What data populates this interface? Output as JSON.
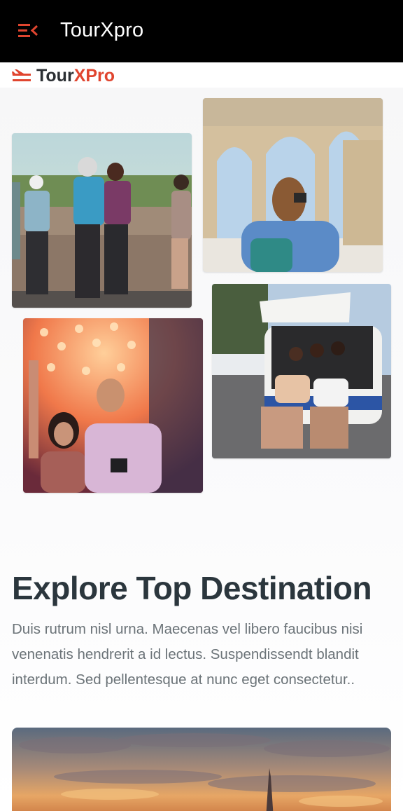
{
  "appbar": {
    "title": "TourXpro",
    "menu_icon": "menu-close-icon",
    "accent_color": "#e0452f"
  },
  "brand": {
    "name_part1": "Tour",
    "name_part2": "XPro",
    "logo_icon": "plane-logo-icon",
    "accent_color": "#e0452f"
  },
  "gallery": {
    "photos": [
      {
        "name": "tourists-photographing-view"
      },
      {
        "name": "woman-photographing-arches"
      },
      {
        "name": "friends-on-van"
      },
      {
        "name": "couple-under-lights"
      }
    ]
  },
  "section": {
    "title": "Explore Top Destination",
    "description": "Duis rutrum nisl urna. Maecenas vel libero faucibus nisi venenatis hendrerit a id lectus. Suspendissendt blandit interdum. Sed pellentesque at nunc eget consectetur.."
  },
  "featured": {
    "name": "eiffel-tower-sunset"
  }
}
